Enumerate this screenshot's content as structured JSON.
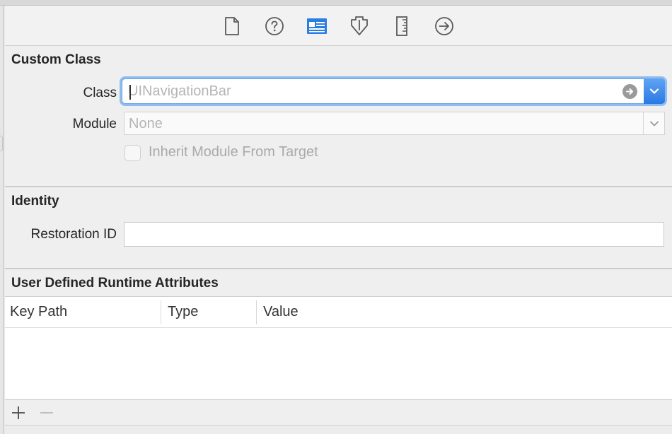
{
  "toolbar": {
    "tabs": [
      {
        "icon": "file-icon",
        "active": false
      },
      {
        "icon": "help-icon",
        "active": false
      },
      {
        "icon": "identity-inspector-icon",
        "active": true
      },
      {
        "icon": "attributes-inspector-icon",
        "active": false
      },
      {
        "icon": "size-inspector-icon",
        "active": false
      },
      {
        "icon": "connections-inspector-icon",
        "active": false
      }
    ]
  },
  "custom_class": {
    "title": "Custom Class",
    "class_label": "Class",
    "class_placeholder": "UINavigationBar",
    "module_label": "Module",
    "module_placeholder": "None",
    "inherit_label": "Inherit Module From Target"
  },
  "identity": {
    "title": "Identity",
    "restoration_label": "Restoration ID",
    "restoration_value": ""
  },
  "runtime": {
    "title": "User Defined Runtime Attributes",
    "columns": [
      "Key Path",
      "Type",
      "Value"
    ],
    "rows": []
  },
  "colors": {
    "accent": "#2a79e3",
    "focus_ring": "#8fbcef",
    "panel_bg": "#efefef"
  }
}
